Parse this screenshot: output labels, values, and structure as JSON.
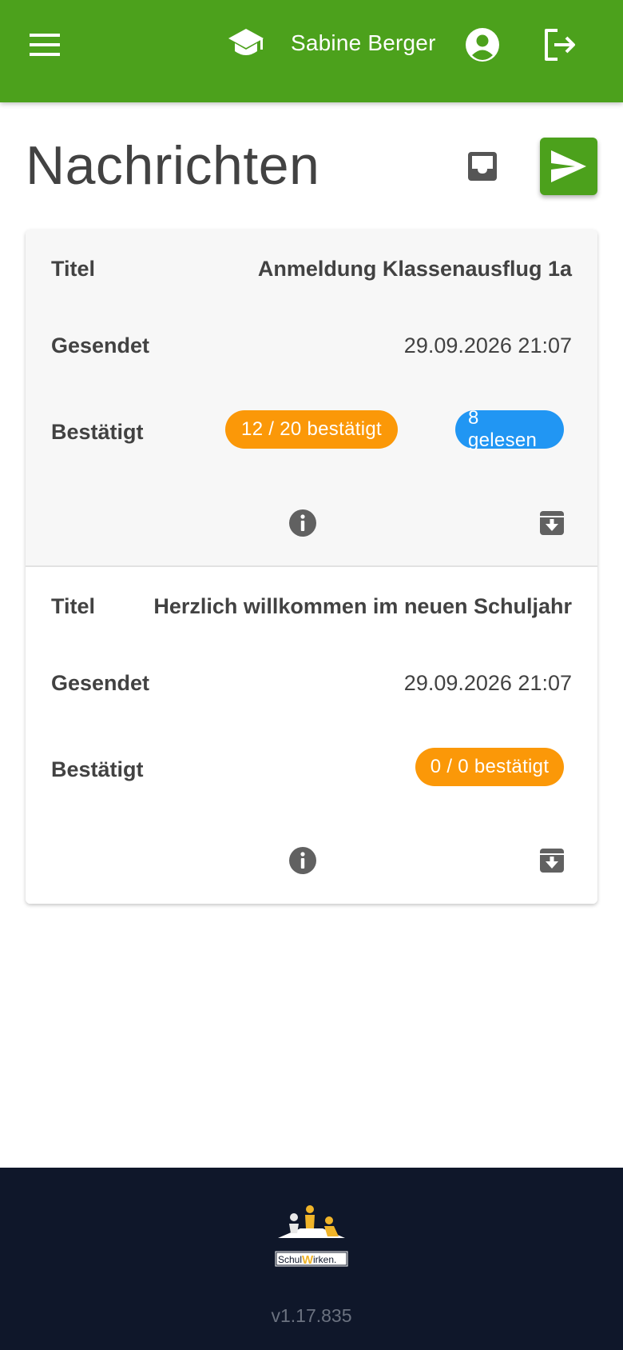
{
  "header": {
    "user_name": "Sabine Berger",
    "icons": {
      "menu": "menu-icon",
      "school": "school-icon",
      "profile": "account-circle-icon",
      "logout": "logout-icon"
    },
    "color": "#4ca11c"
  },
  "page": {
    "title": "Nachrichten",
    "icons": {
      "inbox": "inbox-icon",
      "send": "send-icon"
    }
  },
  "labels": {
    "title": "Titel",
    "sent": "Gesendet",
    "confirmed": "Bestätigt"
  },
  "messages": [
    {
      "title": "Anmeldung Klassenausflug 1a",
      "sent": "29.09.2026 21:07",
      "confirmed_chip": "12 / 20 bestätigt",
      "read_chip": "8 gelesen"
    },
    {
      "title": "Herzlich willkommen im neuen Schuljahr",
      "sent": "29.09.2026 21:07",
      "confirmed_chip": "0 / 0 bestätigt"
    }
  ],
  "colors": {
    "confirmed_chip": "#fb9808",
    "read_chip": "#2196f3",
    "footer": "#0f172a"
  },
  "footer": {
    "logo_text": "SchulWirken.",
    "version": "v1.17.835"
  }
}
